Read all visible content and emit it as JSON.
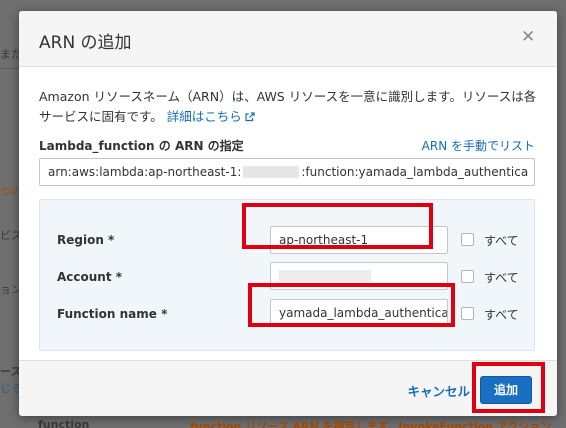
{
  "background": {
    "fragments": [
      "またに",
      "つの",
      "ビス",
      "ョン",
      "ース",
      "じる",
      "function",
      "function リソース ARN を指定します。InvokeFunction アクション"
    ]
  },
  "dialog": {
    "title": "ARN の追加",
    "close_icon": "close-icon",
    "description": "Amazon リソースネーム（ARN）は、AWS リソースを一意に識別します。リソースは各サービスに固有です。",
    "details_link": "詳細はこちら",
    "section_label": "Lambda_function の ARN の指定",
    "manual_link": "ARN を手動でリスト",
    "arn_prefix": "arn:aws:lambda:ap-northeast-1:",
    "arn_suffix": ":function:yamada_lambda_authentica",
    "fields": {
      "region": {
        "label": "Region *",
        "value": "ap-northeast-1",
        "checkbox_label": "すべて"
      },
      "account": {
        "label": "Account *",
        "value": "",
        "checkbox_label": "すべて"
      },
      "function": {
        "label": "Function name *",
        "value": "yamada_lambda_authenticat",
        "checkbox_label": "すべて"
      }
    },
    "cancel_label": "キャンセル",
    "add_label": "追加"
  },
  "colors": {
    "link": "#146eb4",
    "primary_button": "#1a6fc2",
    "highlight_box": "#e0000f",
    "panel_bg": "#f1f6fb"
  }
}
